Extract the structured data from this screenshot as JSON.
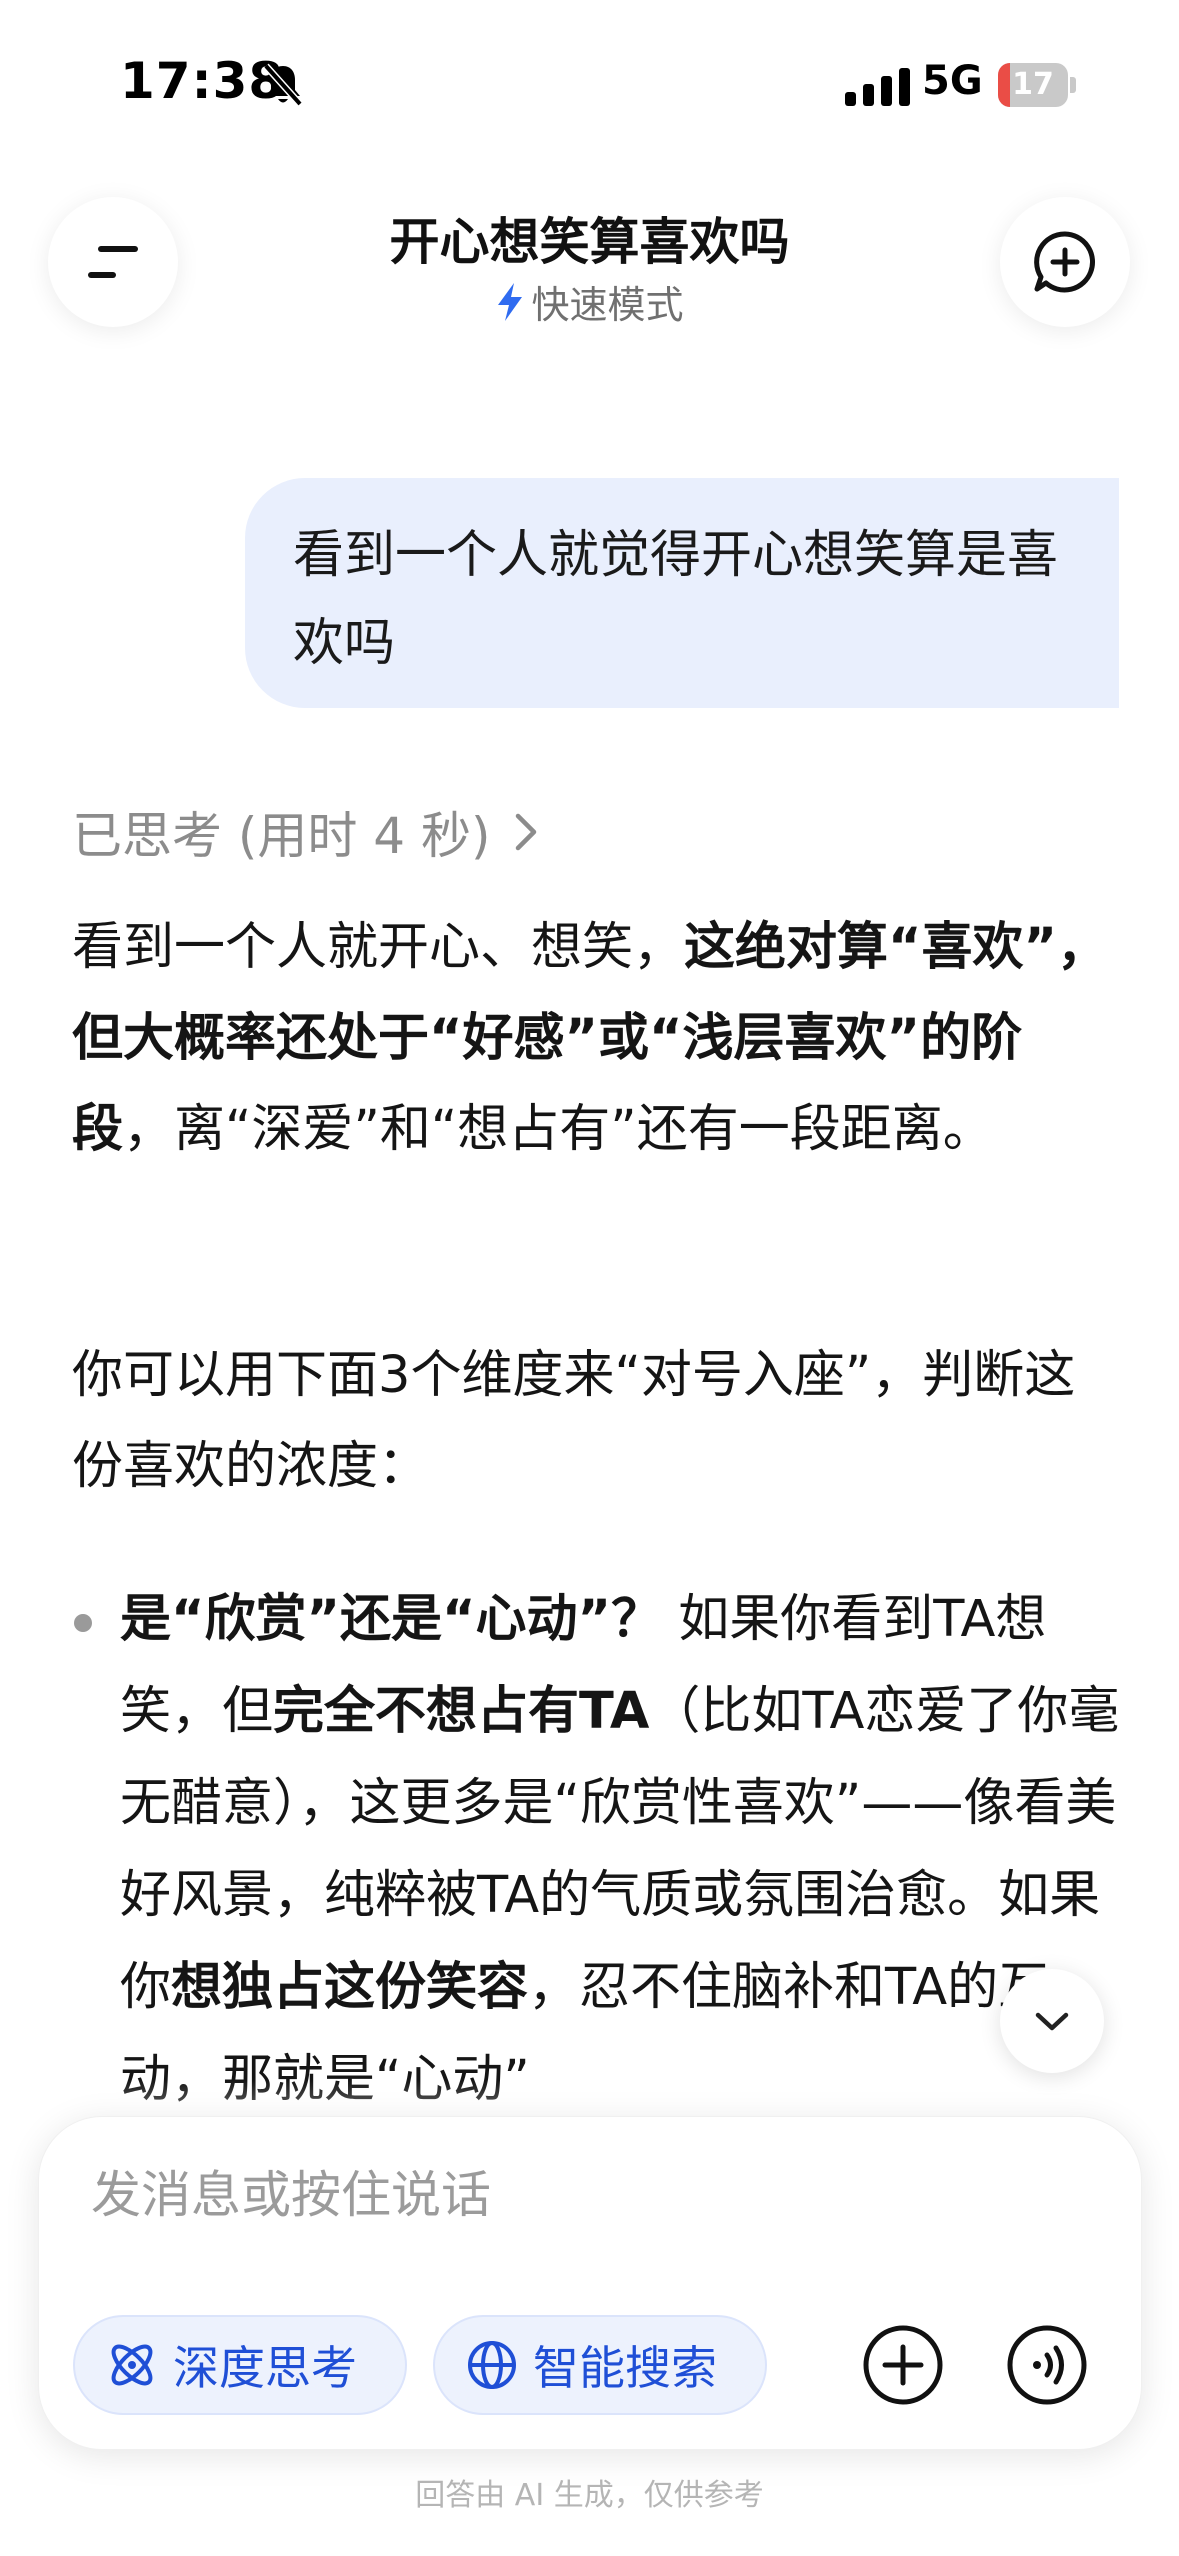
{
  "status_bar": {
    "time": "17:38",
    "network": "5G",
    "battery_level": "17",
    "battery_fraction": 0.17,
    "icons": [
      "bell-slash-icon",
      "signal-icon"
    ]
  },
  "header": {
    "title": "开心想笑算喜欢吗",
    "mode": "快速模式",
    "mode_icon": "lightning-icon",
    "menu_icon": "menu-icon",
    "new_chat_icon": "new-chat-icon"
  },
  "conversation": {
    "user_message": "看到一个人就觉得开心想笑算是喜欢吗",
    "thought_label": "已思考 (用时 4 秒)",
    "answer": {
      "p1": {
        "a": "看到一个人就开心、想笑，",
        "b": "这绝对算“喜欢”，但大概率还处于“好感”或“浅层喜欢”的阶段",
        "c": "，离“深爱”和“想占有”还有一段距离。"
      },
      "p2": "你可以用下面3个维度来“对号入座”，判断这份喜欢的浓度：",
      "bullet1": {
        "a": "是“欣赏”还是“心动”？",
        "b": " 如果你看到TA想笑，但",
        "c": "完全不想占有TA",
        "d": "（比如TA恋爱了你毫无醋意），这更多是“欣赏性喜欢”——像看美好风景，纯粹被TA的气质或氛围治愈。如果你",
        "e": "想独占这份笑容",
        "f": "，忍不住脑补和TA的互动，那就是“心动”"
      }
    }
  },
  "composer": {
    "placeholder": "发消息或按住说话",
    "deep_think_label": "深度思考",
    "smart_search_label": "智能搜索"
  },
  "footer": {
    "disclaimer": "回答由 AI 生成，仅供参考"
  },
  "colors": {
    "accent": "#1f4fd6",
    "user_bubble": "#e9effd",
    "battery_low": "#ea4d46"
  }
}
